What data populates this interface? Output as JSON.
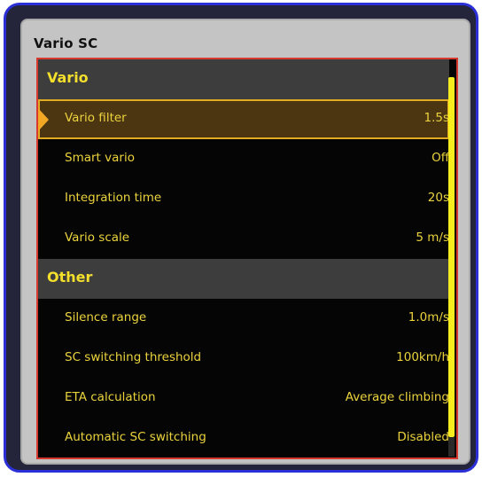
{
  "dialog": {
    "title": "Vario SC"
  },
  "sections": [
    {
      "label": "Vario",
      "items": [
        {
          "label": "Vario filter",
          "value": "1.5s",
          "selected": true
        },
        {
          "label": "Smart vario",
          "value": "Off"
        },
        {
          "label": "Integration time",
          "value": "20s"
        },
        {
          "label": "Vario scale",
          "value": "5 m/s"
        }
      ]
    },
    {
      "label": "Other",
      "items": [
        {
          "label": "Silence range",
          "value": "1.0m/s"
        },
        {
          "label": "SC switching threshold",
          "value": "100km/h"
        },
        {
          "label": "ETA calculation",
          "value": "Average climbing"
        },
        {
          "label": "Automatic SC switching",
          "value": "Disabled"
        }
      ]
    }
  ],
  "colors": {
    "text": "#ebd33d",
    "section_text": "#f3df2c",
    "selection_border": "#e0aa22",
    "list_border": "#d8392f",
    "frame_border": "#2b2fd6",
    "scrollbar": "#f7ec1d"
  },
  "icons": {
    "selection_marker": "selection-arrow-icon"
  }
}
